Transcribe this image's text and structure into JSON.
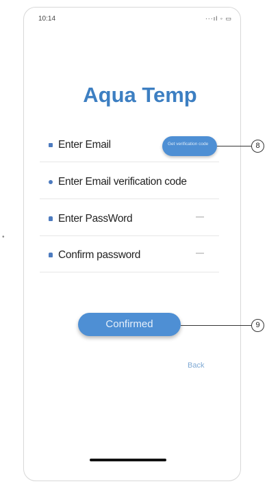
{
  "status_bar": {
    "time": "10:14",
    "indicators": "···ıl ◦ ▭"
  },
  "app_title": "Aqua Temp",
  "form": {
    "fields": [
      {
        "label": "Enter Email",
        "icon": "mail-icon"
      },
      {
        "label": "Enter Email verification code",
        "icon": "shield-icon"
      },
      {
        "label": "Enter PassWord",
        "icon": "lock-icon"
      },
      {
        "label": "Confirm password",
        "icon": "lock-icon"
      }
    ],
    "send_code_button": "Get verification code",
    "confirm_button": "Confirmed",
    "back_link": "Back"
  },
  "callouts": [
    "8",
    "9"
  ],
  "side_mark": "•",
  "colors": {
    "accent": "#4e8fd4",
    "title": "#3d7fc2"
  }
}
